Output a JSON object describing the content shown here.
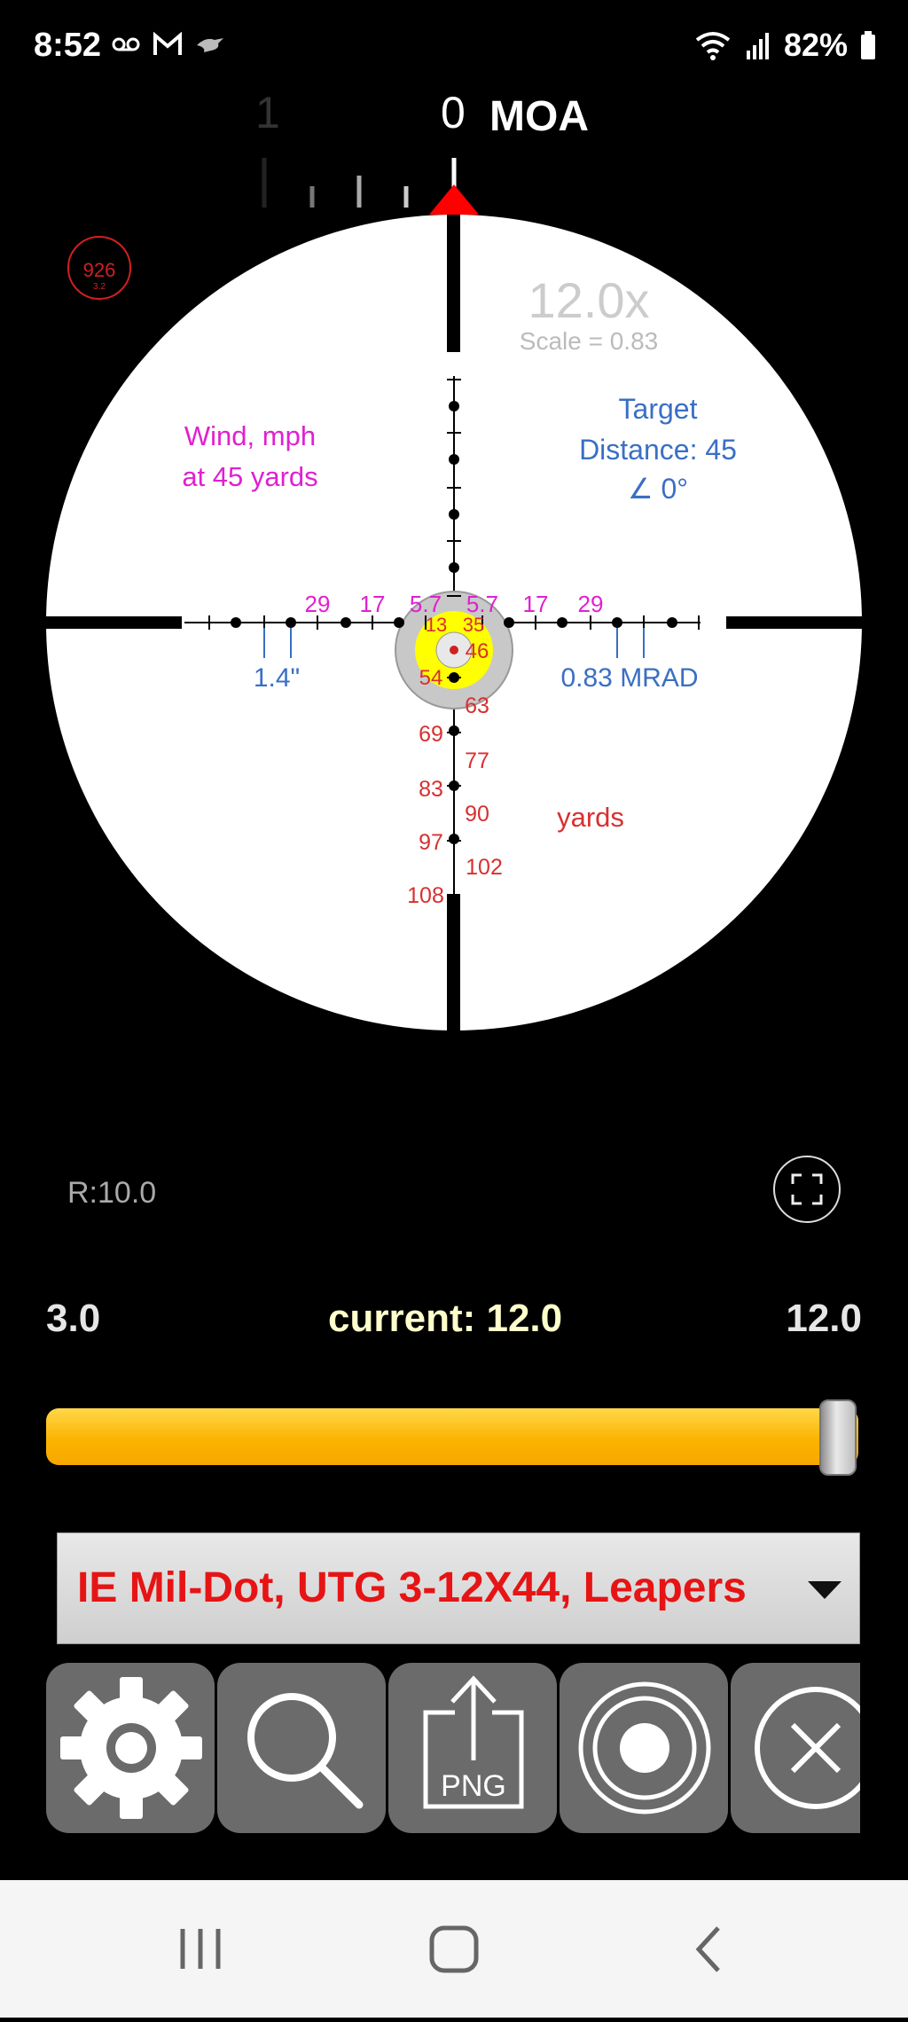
{
  "status_bar": {
    "time": "8:52",
    "battery": "82%"
  },
  "scale_ruler": {
    "zero_label": "0",
    "unit_label": "MOA",
    "left_label": "1"
  },
  "scope": {
    "badge_value": "926",
    "badge_sub": "3.2",
    "magnification": "12.0x",
    "scale_text": "Scale = 0.83",
    "wind_line1": "Wind, mph",
    "wind_line2": "at 45 yards",
    "target_line1": "Target",
    "target_line2": "Distance: 45",
    "target_line3": "∠ 0°",
    "wind_labels_left": [
      "29",
      "17",
      "5.7"
    ],
    "wind_labels_right": [
      "5.7",
      "17",
      "29"
    ],
    "inner_labels": [
      "13",
      "35",
      "46",
      "54"
    ],
    "spacing_inches": "1.4\"",
    "spacing_mrad": "0.83 MRAD",
    "range_labels_left": [
      "69",
      "83",
      "97",
      "108"
    ],
    "range_labels_right": [
      "63",
      "77",
      "90",
      "102"
    ],
    "range_unit": "yards",
    "colors": {
      "wind": "#e020d0",
      "target": "#3a6fc4",
      "range": "#d83030",
      "reticle": "#000000"
    }
  },
  "controls": {
    "radius": "R:10.0",
    "zoom_min": "3.0",
    "zoom_current": "current: 12.0",
    "zoom_max": "12.0",
    "zoom_fraction": 1.0,
    "reticle_select": "IE Mil-Dot, UTG 3-12X44, Leapers"
  },
  "toolbar": {
    "png_label": "PNG",
    "buttons": [
      "gear-icon",
      "search-icon",
      "export-png-icon",
      "target-icon",
      "close-icon"
    ]
  },
  "navbar": {
    "buttons": [
      "recent-apps-icon",
      "home-icon",
      "back-icon"
    ]
  }
}
